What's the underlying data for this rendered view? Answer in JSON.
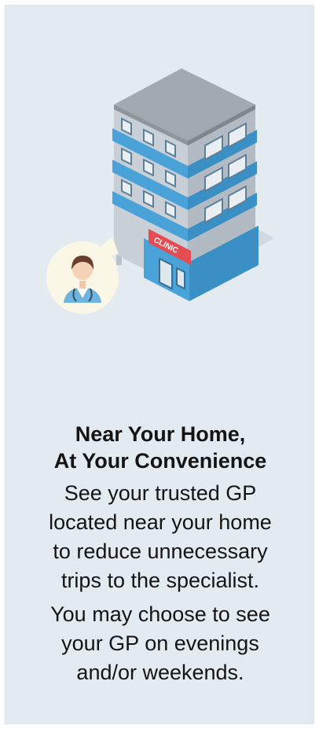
{
  "heading": {
    "line1": "Near Your Home,",
    "line2": "At Your Convenience"
  },
  "paragraph1": {
    "line1": "See your trusted GP",
    "line2": "located near your home",
    "line3": "to reduce unnecessary",
    "line4": "trips to the specialist."
  },
  "paragraph2": {
    "line1": "You may choose to see",
    "line2": "your GP on evenings",
    "line3": "and/or weekends."
  },
  "illustration": {
    "sign_text": "CLINIC",
    "icons": [
      "clinic-building-icon",
      "doctor-avatar-icon"
    ],
    "colors": {
      "card_background": "#e3ebf1",
      "building_blue": "#4aa3d8",
      "building_grey": "#c9cfd6",
      "sign_red": "#e44b52",
      "bubble": "#fbf7e6"
    }
  }
}
